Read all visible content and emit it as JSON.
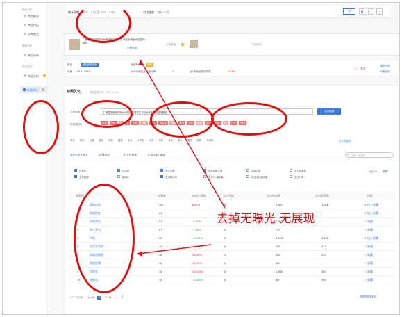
{
  "sidebar": {
    "sections": [
      "商品分析",
      "营销分析",
      "商品监控"
    ],
    "items": [
      "商品概况",
      "商品排行",
      "异常商品",
      "新品分析",
      "单品分析",
      "标题优化"
    ],
    "active": "标题优化"
  },
  "topbar": {
    "period_label": "统计周期",
    "period_value": "2020-11-02 至 2020-11-08",
    "terminal_label": "对比维度",
    "terminal_value": "统一个历"
  },
  "product": {
    "title": "厂家直销新款时尚休闲双肩包男学生书包女韩版大容量电脑包",
    "link": "查看商品",
    "compare_label": "本店商品",
    "compare_hint": "同类商品"
  },
  "price_row": {
    "label1": "价格",
    "value1": "¥3.3 - ¥29.9",
    "label2": "近30天商品支付转化率",
    "value2": "1",
    "label3": "近7天商品支付件数",
    "value3": "53.6%",
    "follow": "关注",
    "link1": "单品分析",
    "link2": "标题优化"
  },
  "optimize": {
    "heading": "标题优化",
    "updated": "数据更新时间：2020-11-08",
    "title_label": "当前标题",
    "title_text": "厂家直销新款时尚休闲双肩包男学生书包女韩版大容量电脑包",
    "submit": "优化标题",
    "tags_label": "热搜词推荐",
    "tags_red": [
      "双肩",
      "背包",
      "男",
      "女",
      "书包",
      "电脑",
      "学生",
      "大容量",
      "韩版",
      "时尚",
      "旅行",
      "休闲",
      "初中",
      "高中",
      "ins",
      "户外",
      "PRO"
    ],
    "tags_plain": [
      "背包",
      "简约",
      "百搭",
      "潮流",
      "商务",
      "轻便",
      "防水",
      "大学生",
      "小学",
      "日系",
      "森系",
      "男女",
      "通勤",
      "帆布",
      "牛津布"
    ],
    "more": "更多热搜词"
  },
  "tabs": [
    "商品关联搜索词",
    "Top搜索词趋势",
    "行业搜索词",
    "搜索词分析"
  ],
  "subtabs": [
    "商品引流关键词",
    "Top搜索词",
    "行业搜索词",
    "引流词实时跟踪"
  ],
  "search_placeholder": "请输入关键词",
  "metrics": [
    "访客数",
    "访问量",
    "支付件数",
    "商品收藏人数",
    "加购人数",
    "支付买家数",
    "支付金额",
    "客单价",
    "支付转化率",
    "商品PC端访客",
    "商品无线端访客",
    "支付订单"
  ],
  "pagination_info": "已选 5/5",
  "table": {
    "headers": [
      "搜索词",
      "访客数",
      "较前一周期",
      "支付件数",
      "支付转化率",
      "支付买家数",
      "操作"
    ],
    "rows": [
      {
        "rank": "1",
        "word": "双肩包男",
        "visitors": "111",
        "change": "6.87%",
        "pay": "6",
        "conv": "1,567",
        "buyers": "1,626",
        "op": "加入收藏"
      },
      {
        "rank": "2",
        "word": "双肩包女",
        "visitors": "84",
        "change": "-",
        "pay": "0",
        "conv": "-",
        "buyers": "-",
        "op": "加入收藏"
      },
      {
        "rank": "3",
        "word": "双肩背包",
        "visitors": "54",
        "change": "-8.30%",
        "pay": "1",
        "conv": "2,307",
        "buyers": "-",
        "op": "收藏"
      },
      {
        "rank": "4",
        "word": "男士背包",
        "visitors": "37",
        "change": "-7.50%",
        "pay": "3",
        "conv": "737",
        "buyers": "-",
        "op": "收藏"
      },
      {
        "rank": "5",
        "word": "书包",
        "visitors": "22",
        "change": "-24.14%",
        "pay": "0",
        "conv": "8,223",
        "buyers": "3,135",
        "op": "加入收藏"
      },
      {
        "rank": "6",
        "word": "大学生书包",
        "visitors": "19",
        "change": "-13.64%",
        "pay": "0",
        "conv": "799",
        "buyers": "313",
        "op": "收藏"
      },
      {
        "rank": "7",
        "word": "双肩包韩版",
        "visitors": "16",
        "change": "33.45%",
        "pay": "1",
        "conv": "425",
        "buyers": "223",
        "op": "收藏"
      },
      {
        "rank": "8",
        "word": "双肩包潮",
        "visitors": "16",
        "change": "14.29%",
        "pay": "3",
        "conv": "380",
        "buyers": "-",
        "op": "收藏"
      },
      {
        "rank": "9",
        "word": "书包女",
        "visitors": "15",
        "change": "200.00%",
        "pay": "0",
        "conv": "1,990",
        "buyers": "390",
        "op": "收藏"
      },
      {
        "rank": "10",
        "word": "电脑包",
        "visitors": "13",
        "change": "-12.50%",
        "pay": "0",
        "conv": "887",
        "buyers": "290",
        "op": "收藏"
      }
    ]
  },
  "pager": {
    "info": "1-10 共26条",
    "prev": "上一页",
    "next": "下一页",
    "more": "查看更多搜索词"
  },
  "annotation": "去掉无曝光 无展现",
  "colors": {
    "accent": "#3a7be0",
    "red_annotation": "#e01010",
    "tag_red": "#e96b6b"
  }
}
